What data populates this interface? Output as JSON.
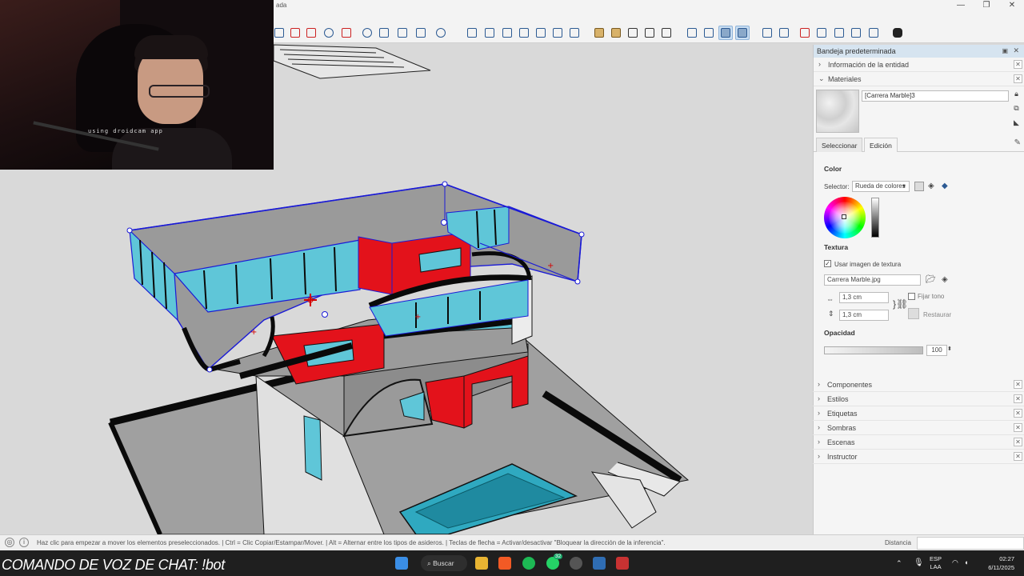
{
  "titlebar": {
    "menu_fragment": "ada",
    "minimize": "—",
    "maximize": "❐",
    "close": "✕"
  },
  "webcam": {
    "overlay_text": "using droidcam app"
  },
  "tray": {
    "title": "Bandeja predeterminada",
    "entity_info": "Información de la entidad",
    "materials_header": "Materiales",
    "material_name": "[Carrera Marble]3",
    "tab_select": "Seleccionar",
    "tab_edit": "Edición",
    "color_label": "Color",
    "selector_label": "Selector:",
    "selector_value": "Rueda de colores",
    "texture_label": "Textura",
    "use_texture_label": "Usar imagen de textura",
    "texture_file": "Carrera Marble.jpg",
    "width_value": "1,3 cm",
    "height_value": "1,3 cm",
    "fix_tone_label": "Fijar tono",
    "restore_label": "Restaurar",
    "opacity_label": "Opacidad",
    "opacity_value": "100",
    "opacity_level": 1.0,
    "collapsed_panels": [
      "Componentes",
      "Estilos",
      "Etiquetas",
      "Sombras",
      "Escenas",
      "Instructor"
    ]
  },
  "statusbar": {
    "hint": "Haz clic para empezar a mover los elementos preseleccionados. | Ctrl = Clic Copiar/Estampar/Mover. | Alt = Alternar entre los tipos de asideros. | Teclas de flecha = Activar/desactivar \"Bloquear la dirección de la inferencia\".",
    "distance_label": "Distancia",
    "distance_value": ""
  },
  "taskbar": {
    "voice_command": "COMANDO DE VOZ DE CHAT: !bot",
    "search_label": "Buscar",
    "whatsapp_badge": "32",
    "lang_top": "ESP",
    "lang_bottom": "LAA",
    "time": "02:27",
    "date": "6/11/2025"
  },
  "colors": {
    "accent": "#2c5a93",
    "selection_blue": "#1a1ad6",
    "wall_red": "#e3121b",
    "glass": "#5fc6d8",
    "pool": "#2fa9c0",
    "floor_gray": "#9b9b9b",
    "taskbar": "#1f1f1f"
  },
  "icons": [
    "search-icon",
    "zoom-extents-icon",
    "orbit-icon",
    "pan-icon",
    "section-plane-icon",
    "component-box-icon",
    "paint-bucket-icon",
    "extension-hex-icon"
  ]
}
